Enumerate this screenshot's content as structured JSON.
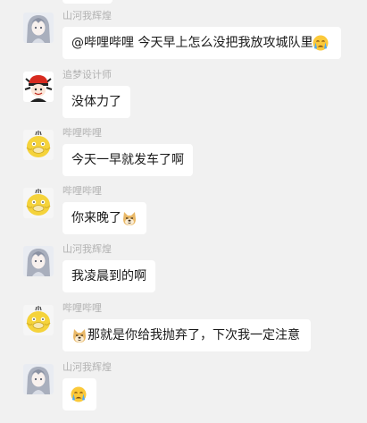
{
  "messages": [
    {
      "sender": "山河我辉煌",
      "avatar_icon": "anime-girl-avatar-icon",
      "text": "@哔哩哔哩 今天早上怎么没把我放攻城队里",
      "trailing_emoji": "sob-icon"
    },
    {
      "sender": "追梦设计师",
      "avatar_icon": "red-cap-character-avatar-icon",
      "text": "没体力了"
    },
    {
      "sender": "哔哩哔哩",
      "avatar_icon": "psyduck-avatar-icon",
      "text": "今天一早就发车了啊"
    },
    {
      "sender": "哔哩哔哩",
      "avatar_icon": "psyduck-avatar-icon",
      "text": "你来晚了",
      "trailing_emoji": "doge-icon"
    },
    {
      "sender": "山河我辉煌",
      "avatar_icon": "anime-girl-avatar-icon",
      "text": "我凌晨到的啊"
    },
    {
      "sender": "哔哩哔哩",
      "avatar_icon": "psyduck-avatar-icon",
      "leading_emoji": "doge-icon",
      "text": "那就是你给我抛弃了，下次我一定注意"
    },
    {
      "sender": "山河我辉煌",
      "avatar_icon": "anime-girl-avatar-icon",
      "trailing_emoji": "sob-icon"
    }
  ],
  "colors": {
    "background": "#f1f1f1",
    "bubble": "#ffffff",
    "sender_name": "#b2b2b2",
    "message_text": "#191919",
    "psyduck_yellow": "#f5d33b"
  }
}
